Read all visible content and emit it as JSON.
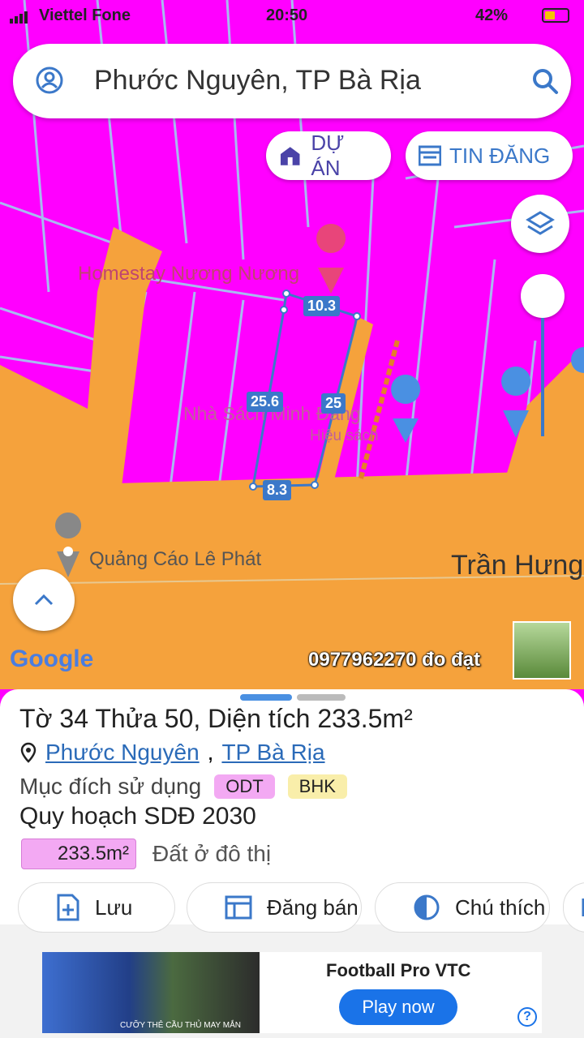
{
  "status_bar": {
    "carrier": "Viettel Fone",
    "time": "20:50",
    "battery": "42%"
  },
  "search": {
    "text": "Phước Nguyên, TP Bà Rịa"
  },
  "chips": {
    "du_an": "DỰ ÁN",
    "tin_dang": "TIN ĐĂNG"
  },
  "map": {
    "poi_homestay": "Homestay Nương Nương",
    "poi_nhasach": "Nhà Sách Minh Đăng",
    "poi_hieusach": "Hiệu sách",
    "poi_quangcao": "Quảng Cáo Lê Phát",
    "road_name": "Trần Hưng",
    "google_logo": "Google",
    "phone_label": "0977962270 đo đạt",
    "dim_top": "10.3",
    "dim_left": "25.6",
    "dim_right": "25",
    "dim_bottom": "8.3",
    "colors": {
      "residential": "#f0f",
      "road": "#f5a23c",
      "parcel_line": "#8fa8e8",
      "boundary": "#3b78c9"
    }
  },
  "sheet": {
    "title_prefix": "Tờ",
    "sheet_no": "34",
    "plot_word": "Thửa",
    "plot_no": "50",
    "area_word": "Diện tích",
    "area_value": "233.5m²",
    "address_ward": "Phước Nguyên",
    "address_city": "TP Bà Rịa",
    "purpose_label": "Mục đích sử dụng",
    "tag_odt": "ODT",
    "tag_bhk": "BHK",
    "plan_label": "Quy hoạch SDĐ 2030",
    "plan_area": "233.5m²",
    "plan_desc": "Đất ở đô thị"
  },
  "actions": {
    "save": "Lưu",
    "sell": "Đăng bán",
    "legend": "Chú thích"
  },
  "ad": {
    "name": "Football Pro VTC",
    "cta": "Play now",
    "caption": "CƯỠY THẺ CẦU THỦ MAY MẮN"
  }
}
